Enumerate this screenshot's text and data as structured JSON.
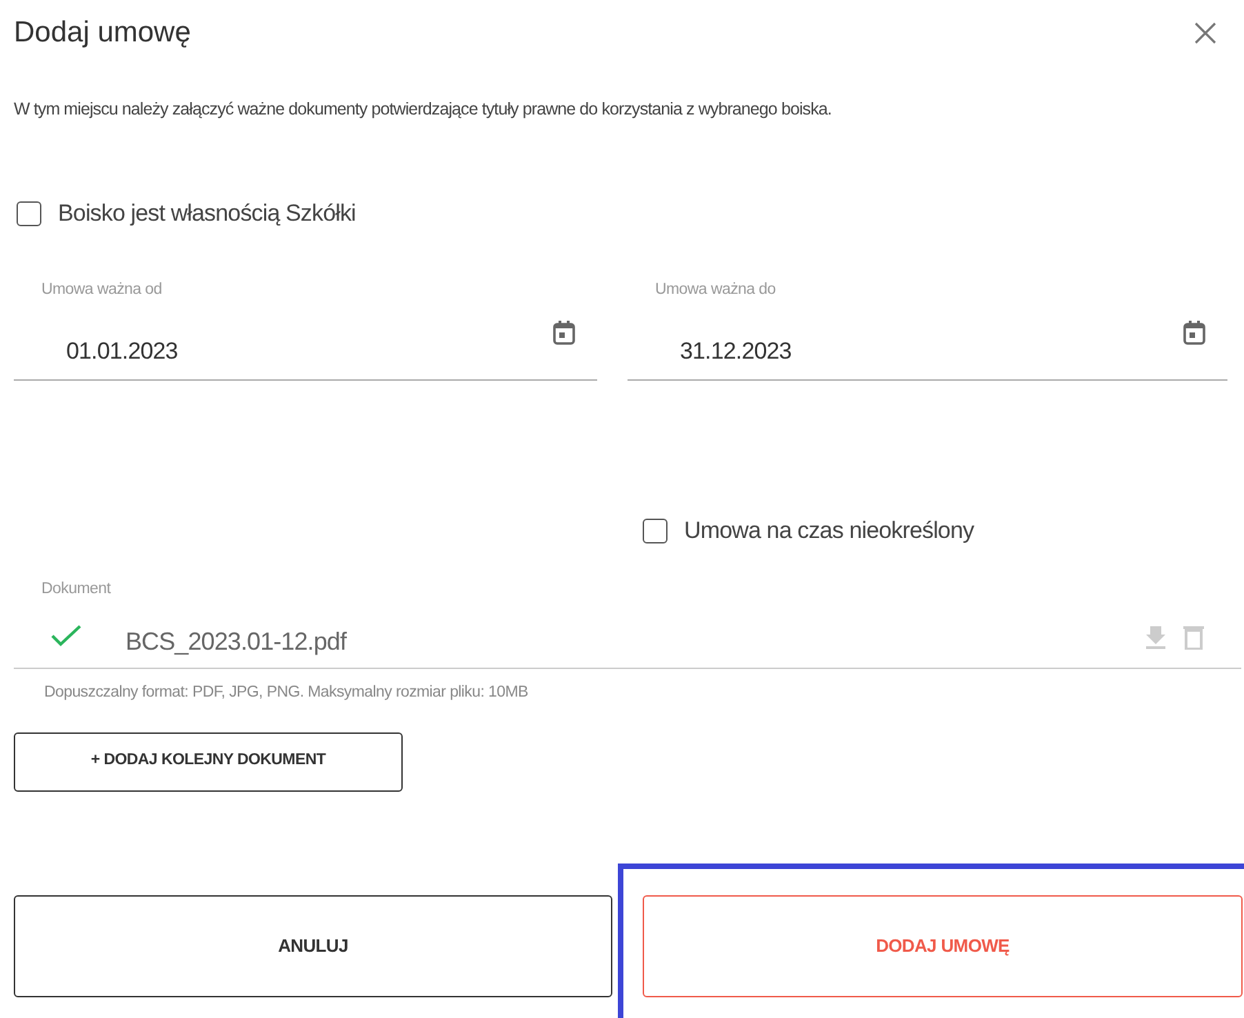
{
  "dialog": {
    "title": "Dodaj umowę",
    "description": "W tym miejscu należy załączyć ważne dokumenty potwierdzające tytuły prawne do korzystania z wybranego boiska."
  },
  "owned_checkbox": {
    "label": "Boisko jest własnością Szkółki",
    "checked": false
  },
  "date_fields": [
    {
      "label": "Umowa ważna od",
      "value": "01.01.2023"
    },
    {
      "label": "Umowa ważna do",
      "value": "31.12.2023"
    }
  ],
  "indefinite_checkbox": {
    "label": "Umowa na czas nieokreślony",
    "checked": false
  },
  "document": {
    "label": "Dokument",
    "file_name": "BCS_2023.01-12.pdf",
    "uploaded": true,
    "hint": "Dopuszczalny format: PDF, JPG, PNG. Maksymalny rozmiar pliku: 10MB"
  },
  "add_document_button": "+ DODAJ KOLEJNY DOKUMENT",
  "buttons": [
    {
      "label": "ANULUJ",
      "kind": "secondary",
      "highlighted": false
    },
    {
      "label": "DODAJ UMOWĘ",
      "kind": "primary",
      "highlighted": true
    }
  ]
}
